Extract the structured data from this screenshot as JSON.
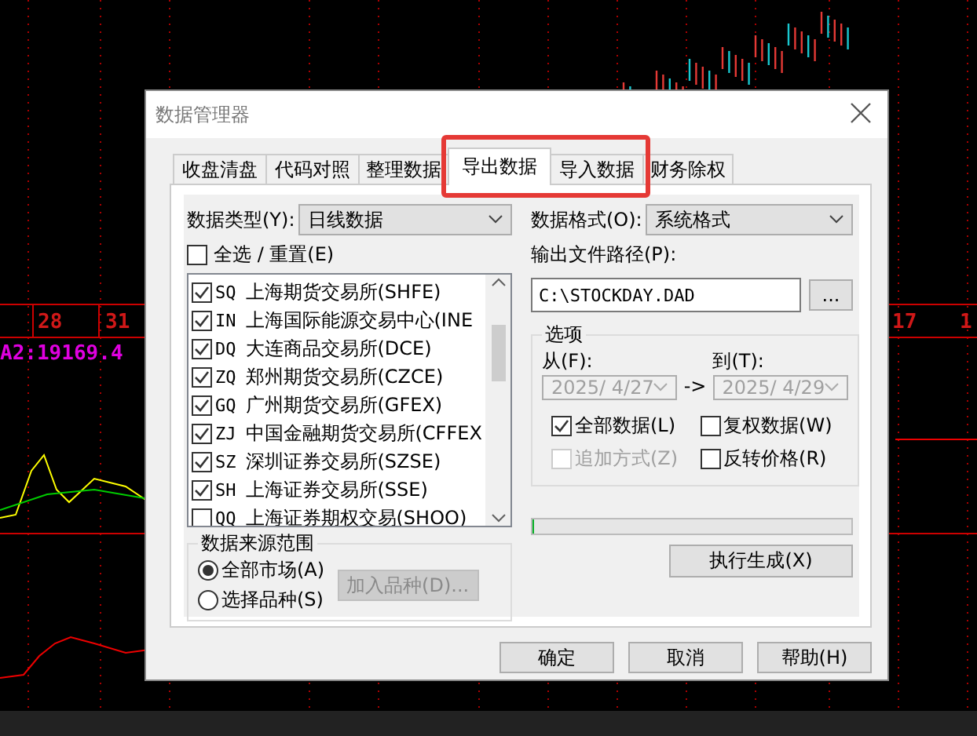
{
  "chart": {
    "date_labels": [
      "28",
      "31",
      "17",
      "1"
    ],
    "indicator": "A2:19169.4"
  },
  "dialog": {
    "title": "数据管理器",
    "tabs": [
      {
        "label": "收盘清盘",
        "selected": false,
        "highlighted": false
      },
      {
        "label": "代码对照",
        "selected": false,
        "highlighted": false
      },
      {
        "label": "整理数据",
        "selected": false,
        "highlighted": false
      },
      {
        "label": "导出数据",
        "selected": true,
        "highlighted": true
      },
      {
        "label": "导入数据",
        "selected": false,
        "highlighted": true
      },
      {
        "label": "财务除权",
        "selected": false,
        "highlighted": false
      }
    ],
    "data_type": {
      "label": "数据类型(Y):",
      "value": "日线数据"
    },
    "select_all": {
      "label": "全选 / 重置(E)",
      "checked": false
    },
    "markets": [
      {
        "code": "SQ",
        "name": "上海期货交易所(SHFE)",
        "checked": true
      },
      {
        "code": "IN",
        "name": "上海国际能源交易中心(INE",
        "checked": true
      },
      {
        "code": "DQ",
        "name": "大连商品交易所(DCE)",
        "checked": true
      },
      {
        "code": "ZQ",
        "name": "郑州期货交易所(CZCE)",
        "checked": true
      },
      {
        "code": "GQ",
        "name": "广州期货交易所(GFEX)",
        "checked": true
      },
      {
        "code": "ZJ",
        "name": "中国金融期货交易所(CFFEX",
        "checked": true
      },
      {
        "code": "SZ",
        "name": "深圳证券交易所(SZSE)",
        "checked": true
      },
      {
        "code": "SH",
        "name": "上海证券交易所(SSE)",
        "checked": true
      },
      {
        "code": "QQ",
        "name": "上海证券期权交易(SHOO)",
        "checked": false
      }
    ],
    "source": {
      "title": "数据来源范围",
      "options": [
        {
          "label": "全部市场(A)",
          "selected": true
        },
        {
          "label": "选择品种(S)",
          "selected": false
        }
      ],
      "add_button": {
        "label": "加入品种(D)...",
        "disabled": true
      }
    },
    "format": {
      "label": "数据格式(O):",
      "value": "系统格式"
    },
    "path": {
      "label": "输出文件路径(P):",
      "value": "C:\\STOCKDAY.DAD",
      "browse": "..."
    },
    "options": {
      "title": "选项",
      "from": {
        "label": "从(F):",
        "value": "2025/ 4/27",
        "disabled": true
      },
      "arrow": "->",
      "to": {
        "label": "到(T):",
        "value": "2025/ 4/29",
        "disabled": true
      },
      "checks": [
        {
          "label": "全部数据(L)",
          "checked": true,
          "disabled": false
        },
        {
          "label": "复权数据(W)",
          "checked": false,
          "disabled": false
        },
        {
          "label": "追加方式(Z)",
          "checked": false,
          "disabled": true
        },
        {
          "label": "反转价格(R)",
          "checked": false,
          "disabled": false
        }
      ]
    },
    "progress": {
      "level": 0
    },
    "execute": "执行生成(X)",
    "buttons": [
      "确定",
      "取消",
      "帮助(H)"
    ]
  }
}
